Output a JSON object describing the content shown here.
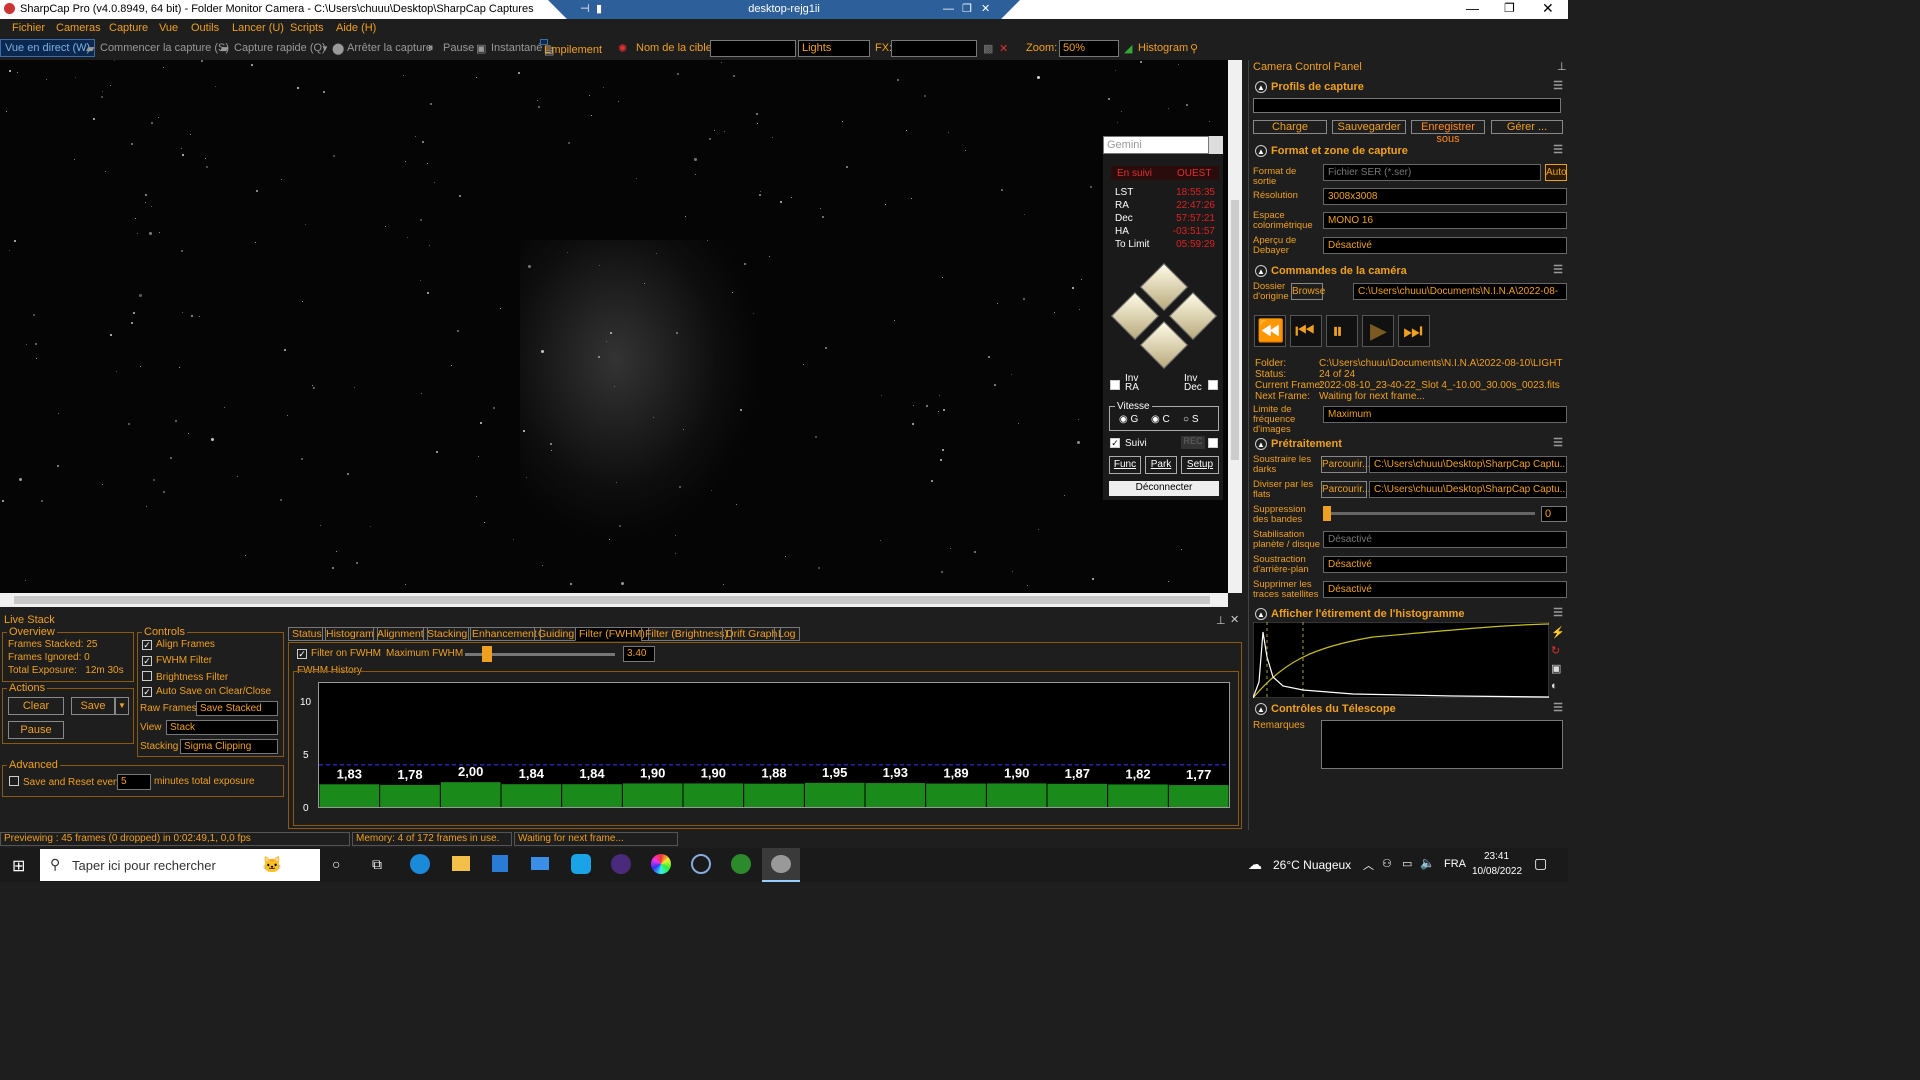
{
  "window": {
    "title": "SharpCap Pro (v4.0.8949, 64 bit) - Folder Monitor Camera - C:\\Users\\chuuu\\Desktop\\SharpCap Captures",
    "rdp_title": "desktop-rejg1ii"
  },
  "menu": [
    "Fichier",
    "Cameras",
    "Capture",
    "Vue",
    "Outils",
    "Lancer (U)",
    "Scripts",
    "Aide (H)"
  ],
  "toolbar": {
    "live": "Vue en direct (W)",
    "start": "Commencer la capture (S)",
    "quick": "Capture rapide (Q)",
    "stop": "Arrêter la capture",
    "pause": "Pause",
    "snap": "Instantané",
    "stack": "Empilement",
    "target_label": "Nom de la cible:",
    "target_value": "",
    "frame_type": "Lights",
    "fx_label": "FX:",
    "fx_value": "",
    "zoom_label": "Zoom:",
    "zoom": "50%",
    "histogram": "Histogram"
  },
  "mount": {
    "name": "Gemini",
    "tracking": "En suivi",
    "side": "OUEST",
    "lst_l": "LST",
    "lst": "18:55:35",
    "ra_l": "RA",
    "ra": "22:47:26",
    "dec_l": "Dec",
    "dec": "57:57:21",
    "ha_l": "HA",
    "ha": "-03:51:57",
    "limit_l": "To Limit",
    "limit": "05:59:29",
    "inv_ra": "Inv RA",
    "inv_dec": "Inv Dec",
    "speed": "Vitesse",
    "g": "G",
    "c": "C",
    "s": "S",
    "suivi": "Suivi",
    "rec": "REC",
    "func": "Func",
    "park": "Park",
    "setup": "Setup",
    "disconnect": "Déconnecter"
  },
  "ccp": {
    "title": "Camera Control Panel",
    "profiles": {
      "title": "Profils de capture",
      "charge": "Charge",
      "save": "Sauvegarder",
      "saveas": "Enregistrer sous",
      "manage": "Gérer ..."
    },
    "format": {
      "title": "Format et zone de capture",
      "out_l": "Format de sortie",
      "out": "Fichier SER (*.ser)",
      "auto": "Auto",
      "res_l": "Résolution",
      "res": "3008x3008",
      "cs_l": "Espace colorimétrique",
      "cs": "MONO 16",
      "deb_l": "Aperçu de Debayer",
      "deb": "Désactivé"
    },
    "cam": {
      "title": "Commandes de la caméra",
      "dir_l": "Dossier d'origine",
      "browse": "Browse",
      "dir": "C:\\Users\\chuuu\\Documents\\N.I.N.A\\2022-08-",
      "folder_l": "Folder:",
      "folder": "C:\\Users\\chuuu\\Documents\\N.I.N.A\\2022-08-10\\LIGHT",
      "status_l": "Status:",
      "status": "24 of 24",
      "cur_l": "Current Frame:",
      "cur": "2022-08-10_23-40-22_Slot 4_-10.00_30.00s_0023.fits",
      "next_l": "Next Frame:",
      "next": "Waiting for next frame...",
      "rate_l": "Limite de fréquence d'images",
      "rate": "Maximum"
    },
    "pre": {
      "title": "Prétraitement",
      "dark_l": "Soustraire les darks",
      "dark_btn": "Parcourir...",
      "dark": "C:\\Users\\chuuu\\Desktop\\SharpCap Captu...",
      "flat_l": "Diviser par les flats",
      "flat_btn": "Parcourir...",
      "flat": "C:\\Users\\chuuu\\Desktop\\SharpCap Captu...",
      "band_l": "Suppression des bandes",
      "band": "0",
      "stab_l": "Stabilisation planète / disque",
      "stab": "Désactivé",
      "bg_l": "Soustraction d'arrière-plan",
      "bg": "Désactivé",
      "sat_l": "Supprimer les traces satellites",
      "sat": "Désactivé"
    },
    "hist": {
      "title": "Afficher l'étirement de l'histogramme"
    },
    "scope": {
      "title": "Contrôles du Télescope",
      "notes": "Remarques"
    }
  },
  "live": {
    "title": "Live Stack",
    "overview": "Overview",
    "stacked": "Frames Stacked: 25",
    "ignored": "Frames Ignored:  0",
    "exposure": "Total Exposure:   12m 30s",
    "actions": "Actions",
    "clear": "Clear",
    "save": "Save",
    "pause": "Pause",
    "advanced": "Advanced",
    "reset": "Save and Reset every",
    "reset_val": "5",
    "reset_unit": "minutes total exposure",
    "controls": "Controls",
    "align": "Align Frames",
    "fwhm": "FWHM Filter",
    "bright": "Brightness Filter",
    "autosave": "Auto Save on Clear/Close",
    "raw_l": "Raw Frames",
    "raw": "Save Stacked",
    "view_l": "View",
    "view": "Stack",
    "stk_l": "Stacking",
    "stk": "Sigma Clipping",
    "tabs": [
      "Status",
      "Histogram",
      "Alignment",
      "Stacking",
      "Enhancement",
      "Guiding",
      "Filter (FWHM)",
      "Filter (Brightness)",
      "Drift Graph",
      "Log"
    ],
    "filter_on": "Filter on FWHM",
    "max_l": "Maximum FWHM",
    "max": "3.40",
    "hist_title": "FWHM History"
  },
  "chart_data": {
    "type": "bar",
    "title": "FWHM History",
    "ylim": [
      0,
      10
    ],
    "yticks": [
      "10",
      "5",
      "0"
    ],
    "threshold": 3.4,
    "values": [
      1.83,
      1.78,
      2.0,
      1.84,
      1.84,
      1.9,
      1.9,
      1.88,
      1.95,
      1.93,
      1.89,
      1.9,
      1.87,
      1.82,
      1.77
    ],
    "labels": [
      "1,83",
      "1,78",
      "2,00",
      "1,84",
      "1,84",
      "1,90",
      "1,90",
      "1,88",
      "1,95",
      "1,93",
      "1,89",
      "1,90",
      "1,87",
      "1,82",
      "1,77"
    ],
    "bar_color": "#1a8a1a"
  },
  "status": {
    "preview": "Previewing : 45 frames (0 dropped) in 0:02:49,1, 0,0 fps",
    "memory": "Memory: 4 of 172 frames in use.",
    "waiting": "Waiting for next frame..."
  },
  "taskbar": {
    "search": "Taper ici pour rechercher",
    "weather": "26°C  Nuageux",
    "lang": "FRA",
    "time": "23:41",
    "date": "10/08/2022"
  }
}
